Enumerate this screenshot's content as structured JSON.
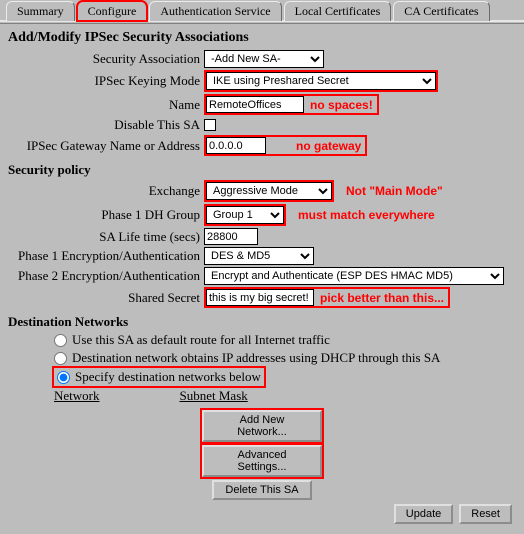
{
  "tabs": {
    "summary": "Summary",
    "configure": "Configure",
    "auth_service": "Authentication Service",
    "local_certs": "Local Certificates",
    "ca_certs": "CA Certificates"
  },
  "heading": "Add/Modify IPSec Security Associations",
  "fields": {
    "sa_label": "Security Association",
    "sa_value": "-Add New SA-",
    "keying_label": "IPSec Keying Mode",
    "keying_value": "IKE using Preshared Secret",
    "name_label": "Name",
    "name_value": "RemoteOffices",
    "name_annot": "no spaces!",
    "disable_label": "Disable This SA",
    "gw_label": "IPSec Gateway Name or Address",
    "gw_value": "0.0.0.0",
    "gw_annot": "no gateway"
  },
  "policy": {
    "header": "Security policy",
    "exchange_label": "Exchange",
    "exchange_value": "Aggressive Mode",
    "exchange_annot": "Not \"Main Mode\"",
    "dh_label": "Phase 1 DH Group",
    "dh_value": "Group 1",
    "dh_annot": "must match everywhere",
    "salife_label": "SA Life time (secs)",
    "salife_value": "28800",
    "p1_label": "Phase 1 Encryption/Authentication",
    "p1_value": "DES & MD5",
    "p2_label": "Phase 2 Encryption/Authentication",
    "p2_value": "Encrypt and Authenticate (ESP DES HMAC MD5)",
    "secret_label": "Shared Secret",
    "secret_value": "this is my big secret!",
    "secret_annot": "pick better than this..."
  },
  "dest": {
    "header": "Destination Networks",
    "r1": "Use this SA as default route for all Internet traffic",
    "r2": "Destination network obtains IP addresses using DHCP through this SA",
    "r3": "Specify destination networks below",
    "col_network": "Network",
    "col_mask": "Subnet Mask"
  },
  "buttons": {
    "add_net": "Add New Network...",
    "adv": "Advanced Settings...",
    "del": "Delete This SA",
    "update": "Update",
    "reset": "Reset"
  }
}
